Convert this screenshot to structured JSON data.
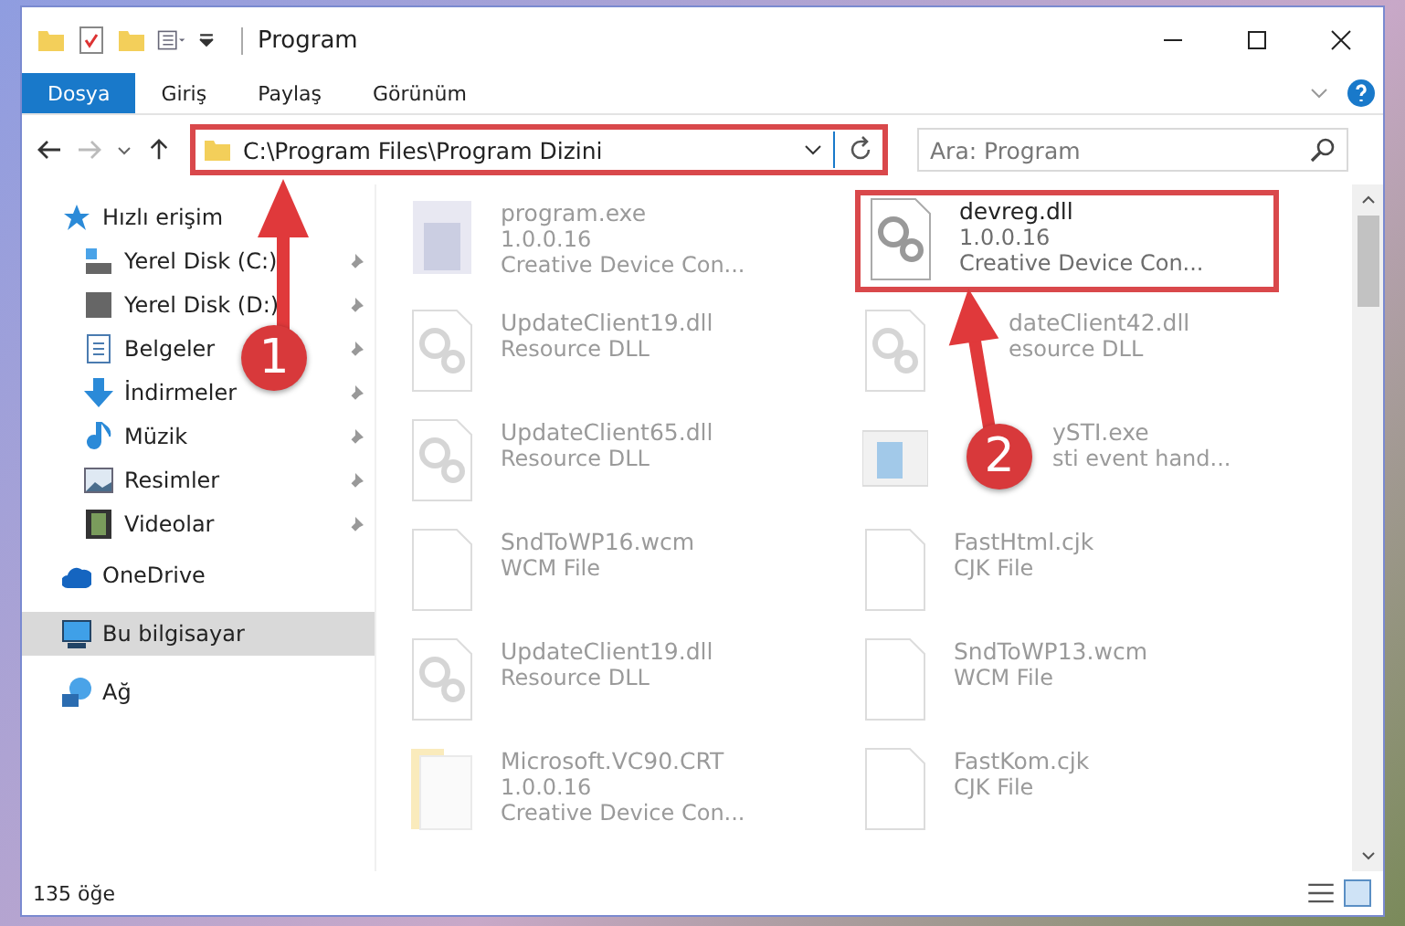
{
  "window": {
    "title": "Program"
  },
  "ribbon_tabs": [
    {
      "label": "Dosya",
      "selected": true
    },
    {
      "label": "Giriş",
      "selected": false
    },
    {
      "label": "Paylaş",
      "selected": false
    },
    {
      "label": "Görünüm",
      "selected": false
    }
  ],
  "address_bar": {
    "path": "C:\\Program Files\\Program Dizini",
    "highlighted": true
  },
  "search": {
    "placeholder": "Ara: Program"
  },
  "sidebar": {
    "items": [
      {
        "label": "Hızlı erişim",
        "kind": "star",
        "selected": false,
        "children": [
          {
            "label": "Yerel Disk (C:)",
            "kind": "drive-c",
            "pinned": true,
            "selected": false
          },
          {
            "label": "Yerel Disk (D:)",
            "kind": "drive",
            "pinned": true,
            "selected": false
          },
          {
            "label": "Belgeler",
            "kind": "document",
            "pinned": true,
            "selected": false
          },
          {
            "label": "İndirmeler",
            "kind": "download",
            "pinned": true,
            "selected": false
          },
          {
            "label": "Müzik",
            "kind": "music",
            "pinned": true,
            "selected": false
          },
          {
            "label": "Resimler",
            "kind": "picture",
            "pinned": true,
            "selected": false
          },
          {
            "label": "Videolar",
            "kind": "video",
            "pinned": true,
            "selected": false
          }
        ]
      },
      {
        "label": "OneDrive",
        "kind": "cloud",
        "selected": false
      },
      {
        "label": "Bu bilgisayar",
        "kind": "computer",
        "selected": true
      },
      {
        "label": "Ağ",
        "kind": "network",
        "selected": false
      }
    ]
  },
  "files": [
    {
      "name": "program.exe",
      "lines": [
        "1.0.0.16",
        "Creative Device Con..."
      ],
      "kind": "exe",
      "highlighted": false
    },
    {
      "name": "devreg.dll",
      "lines": [
        "1.0.0.16",
        "Creative Device Con..."
      ],
      "kind": "dll",
      "highlighted": true
    },
    {
      "name": "UpdateClient19.dll",
      "lines": [
        "Resource DLL"
      ],
      "kind": "dll",
      "highlighted": false
    },
    {
      "name": "dateClient42.dll",
      "lines": [
        "esource DLL"
      ],
      "kind": "dll",
      "highlighted": false
    },
    {
      "name": "UpdateClient65.dll",
      "lines": [
        "Resource DLL"
      ],
      "kind": "dll",
      "highlighted": false
    },
    {
      "name": "ySTI.exe",
      "lines": [
        "sti event hand..."
      ],
      "kind": "app",
      "highlighted": false
    },
    {
      "name": "SndToWP16.wcm",
      "lines": [
        "WCM File"
      ],
      "kind": "file",
      "highlighted": false
    },
    {
      "name": "FastHtml.cjk",
      "lines": [
        "CJK File"
      ],
      "kind": "file",
      "highlighted": false
    },
    {
      "name": "UpdateClient19.dll",
      "lines": [
        "Resource DLL"
      ],
      "kind": "dll",
      "highlighted": false
    },
    {
      "name": "SndToWP13.wcm",
      "lines": [
        "WCM File"
      ],
      "kind": "file",
      "highlighted": false
    },
    {
      "name": "Microsoft.VC90.CRT",
      "lines": [
        "1.0.0.16",
        "Creative Device Con..."
      ],
      "kind": "folder",
      "highlighted": false
    },
    {
      "name": "FastKom.cjk",
      "lines": [
        "CJK File"
      ],
      "kind": "file",
      "highlighted": false
    }
  ],
  "status_bar": {
    "count": "135 öğe"
  },
  "annotations": [
    {
      "label": "1"
    },
    {
      "label": "2"
    }
  ]
}
